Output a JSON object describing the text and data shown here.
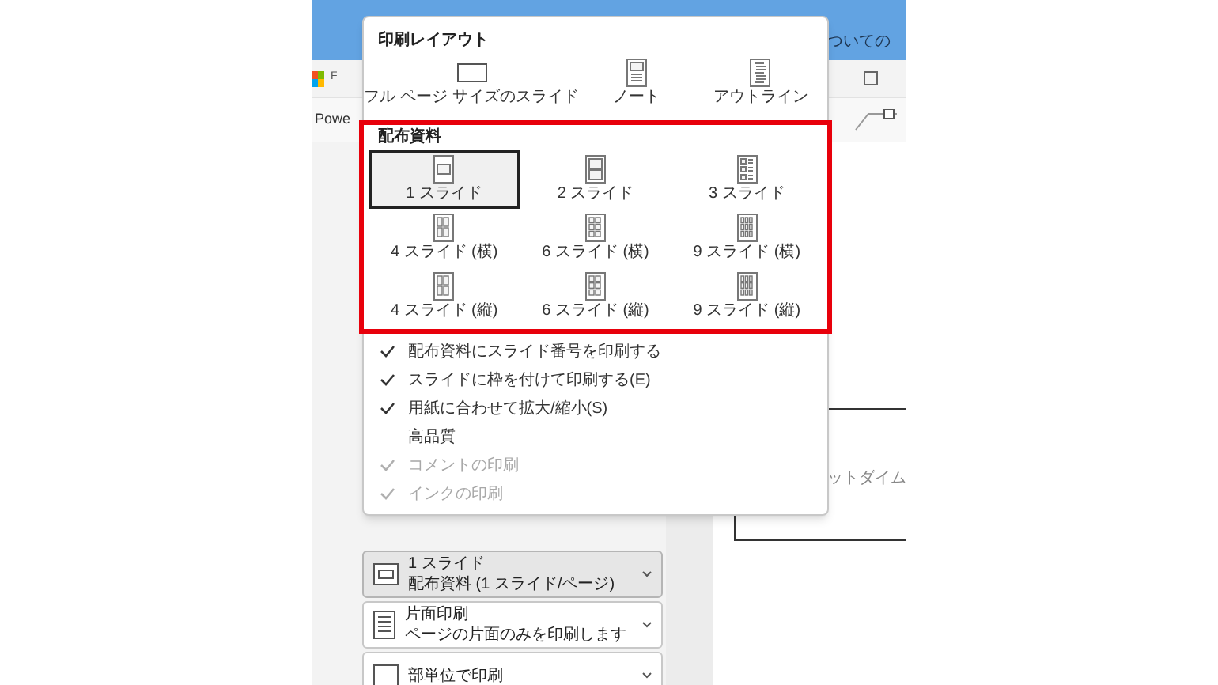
{
  "app_background": {
    "header_text": "ついての",
    "tab_letter": "F",
    "ribbon_text": "Powe",
    "preview_text": "ットダイム"
  },
  "menu": {
    "sections": [
      {
        "title": "印刷レイアウト",
        "highlighted": false,
        "items": [
          {
            "label": "フル ページ サイズのスライド",
            "selected": false
          },
          {
            "label": "ノート",
            "selected": false
          },
          {
            "label": "アウトライン",
            "selected": false
          }
        ]
      },
      {
        "title": "配布資料",
        "highlighted": true,
        "items": [
          {
            "label": "1 スライド",
            "selected": true
          },
          {
            "label": "2 スライド",
            "selected": false
          },
          {
            "label": "3 スライド",
            "selected": false
          },
          {
            "label": "4 スライド (横)",
            "selected": false
          },
          {
            "label": "6 スライド (横)",
            "selected": false
          },
          {
            "label": "9 スライド (横)",
            "selected": false
          },
          {
            "label": "4 スライド (縦)",
            "selected": false
          },
          {
            "label": "6 スライド (縦)",
            "selected": false
          },
          {
            "label": "9 スライド (縦)",
            "selected": false
          }
        ]
      }
    ],
    "options": [
      {
        "label": "配布資料にスライド番号を印刷する",
        "checked": true,
        "disabled": false
      },
      {
        "label": "スライドに枠を付けて印刷する(E)",
        "checked": true,
        "disabled": false
      },
      {
        "label": "用紙に合わせて拡大/縮小(S)",
        "checked": true,
        "disabled": false
      },
      {
        "label": "高品質",
        "checked": false,
        "disabled": false
      },
      {
        "label": "コメントの印刷",
        "checked": true,
        "disabled": true
      },
      {
        "label": "インクの印刷",
        "checked": true,
        "disabled": true
      }
    ]
  },
  "settings_buttons": [
    {
      "title": "1 スライド",
      "subtitle": "配布資料 (1 スライド/ページ)",
      "selected": true
    },
    {
      "title": "片面印刷",
      "subtitle": "ページの片面のみを印刷します",
      "selected": false
    },
    {
      "title": "部単位で印刷",
      "selected": false
    }
  ]
}
